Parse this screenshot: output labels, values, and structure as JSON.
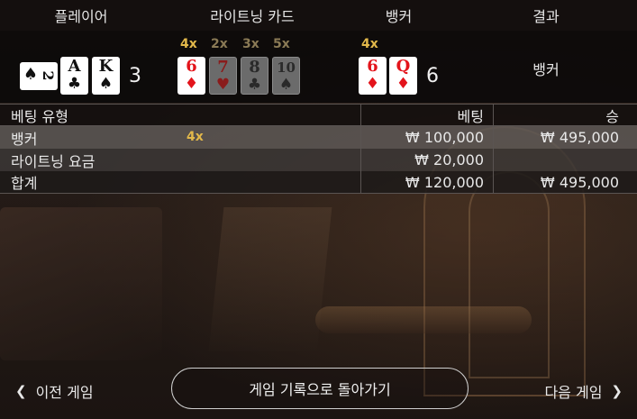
{
  "header": {
    "player": "플레이어",
    "lightning_cards": "라이트닝 카드",
    "banker": "뱅커",
    "result": "결과"
  },
  "player_hand": {
    "cards": [
      {
        "rank": "2",
        "suit": "♠",
        "color": "black"
      },
      {
        "rank": "A",
        "suit": "♣",
        "color": "black"
      },
      {
        "rank": "K",
        "suit": "♠",
        "color": "black"
      }
    ],
    "score": "3"
  },
  "lightning_cards": [
    {
      "multiplier": "4x",
      "rank": "6",
      "suit": "♦",
      "color": "red",
      "active": true
    },
    {
      "multiplier": "2x",
      "rank": "7",
      "suit": "♥",
      "color": "red",
      "active": false
    },
    {
      "multiplier": "3x",
      "rank": "8",
      "suit": "♣",
      "color": "black",
      "active": false
    },
    {
      "multiplier": "5x",
      "rank": "10",
      "suit": "♠",
      "color": "black",
      "active": false
    }
  ],
  "banker_hand": {
    "multiplier": "4x",
    "cards": [
      {
        "rank": "6",
        "suit": "♦",
        "color": "red"
      },
      {
        "rank": "Q",
        "suit": "♦",
        "color": "red"
      }
    ],
    "score": "6"
  },
  "result": "뱅커",
  "bets": {
    "headers": {
      "type": "베팅 유형",
      "bet": "베팅",
      "win": "승"
    },
    "rows": [
      {
        "type": "뱅커",
        "multiplier": "4x",
        "bet": "₩ 100,000",
        "win": "₩ 495,000"
      },
      {
        "type": "라이트닝 요금",
        "multiplier": "",
        "bet": "₩ 20,000",
        "win": ""
      },
      {
        "type": "합계",
        "multiplier": "",
        "bet": "₩ 120,000",
        "win": "₩ 495,000"
      }
    ]
  },
  "footer": {
    "prev": "이전 게임",
    "back": "게임 기록으로 돌아가기",
    "next": "다음 게임"
  },
  "colors": {
    "gold": "#e2b84a",
    "red_suit": "#e3141b"
  }
}
